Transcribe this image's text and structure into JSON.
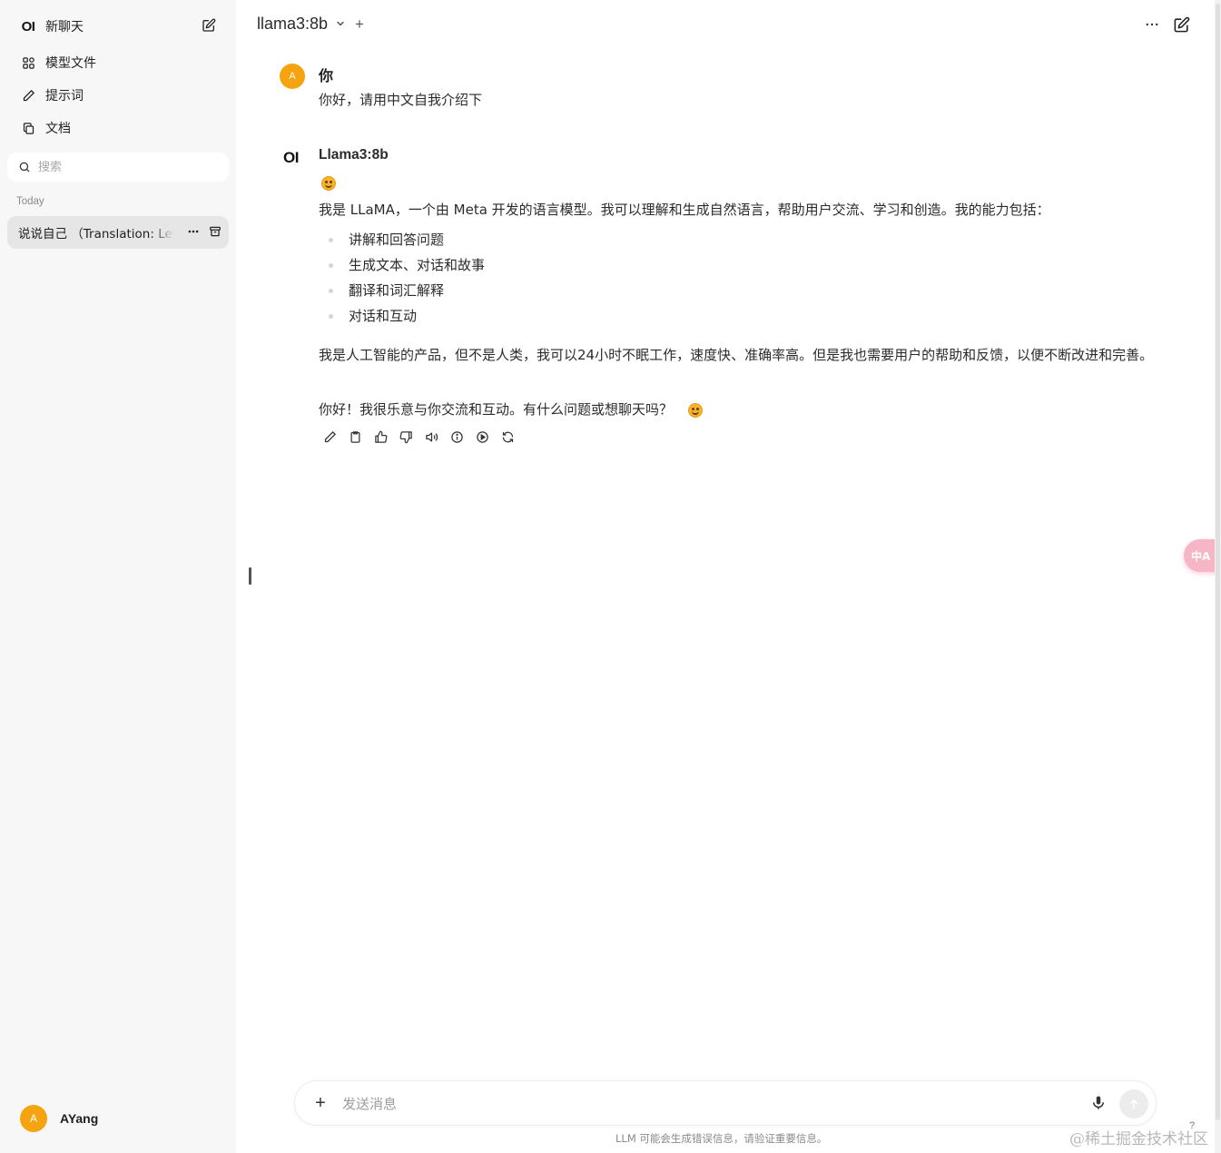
{
  "sidebar": {
    "logo_text": "OI",
    "new_chat_label": "新聊天",
    "nav_items": [
      {
        "label": "模型文件",
        "icon": "grid-icon"
      },
      {
        "label": "提示词",
        "icon": "pencil-icon"
      },
      {
        "label": "文档",
        "icon": "copy-icon"
      }
    ],
    "search_placeholder": "搜索",
    "section_today": "Today",
    "chat_items": [
      {
        "title": "说说自己 （Translation: Let's talk about myself）"
      }
    ],
    "user": {
      "avatar_letter": "A",
      "name": "AYang"
    }
  },
  "header": {
    "model_name": "llama3:8b",
    "add_model_label": "+"
  },
  "messages": {
    "user": {
      "avatar_letter": "A",
      "label": "你",
      "text": "你好，请用中文自我介绍下"
    },
    "assistant": {
      "logo_text": "OI",
      "label": "Llama3:8b",
      "intro": "我是 LLaMA，一个由 Meta 开发的语言模型。我可以理解和生成自然语言，帮助用户交流、学习和创造。我的能力包括：",
      "list": [
        "讲解和回答问题",
        "生成文本、对话和故事",
        "翻译和词汇解释",
        "对话和互动"
      ],
      "para2": "我是人工智能的产品，但不是人类，我可以24小时不眠工作，速度快、准确率高。但是我也需要用户的帮助和反馈，以便不断改进和完善。",
      "para3": "你好！我很乐意与你交流和互动。有什么问题或想聊天吗？"
    }
  },
  "translate_badge": "中A",
  "composer": {
    "placeholder": "发送消息",
    "plus_label": "+"
  },
  "disclaimer": "LLM 可能会生成错误信息，请验证重要信息。",
  "watermark": "@稀土掘金技术社区",
  "help_label": "?",
  "colors": {
    "avatar": "#f5a30f",
    "sidebar_bg": "#f7f7f7",
    "active_chat_bg": "#e6e6e6",
    "translate_badge": "#f7b6c6"
  }
}
